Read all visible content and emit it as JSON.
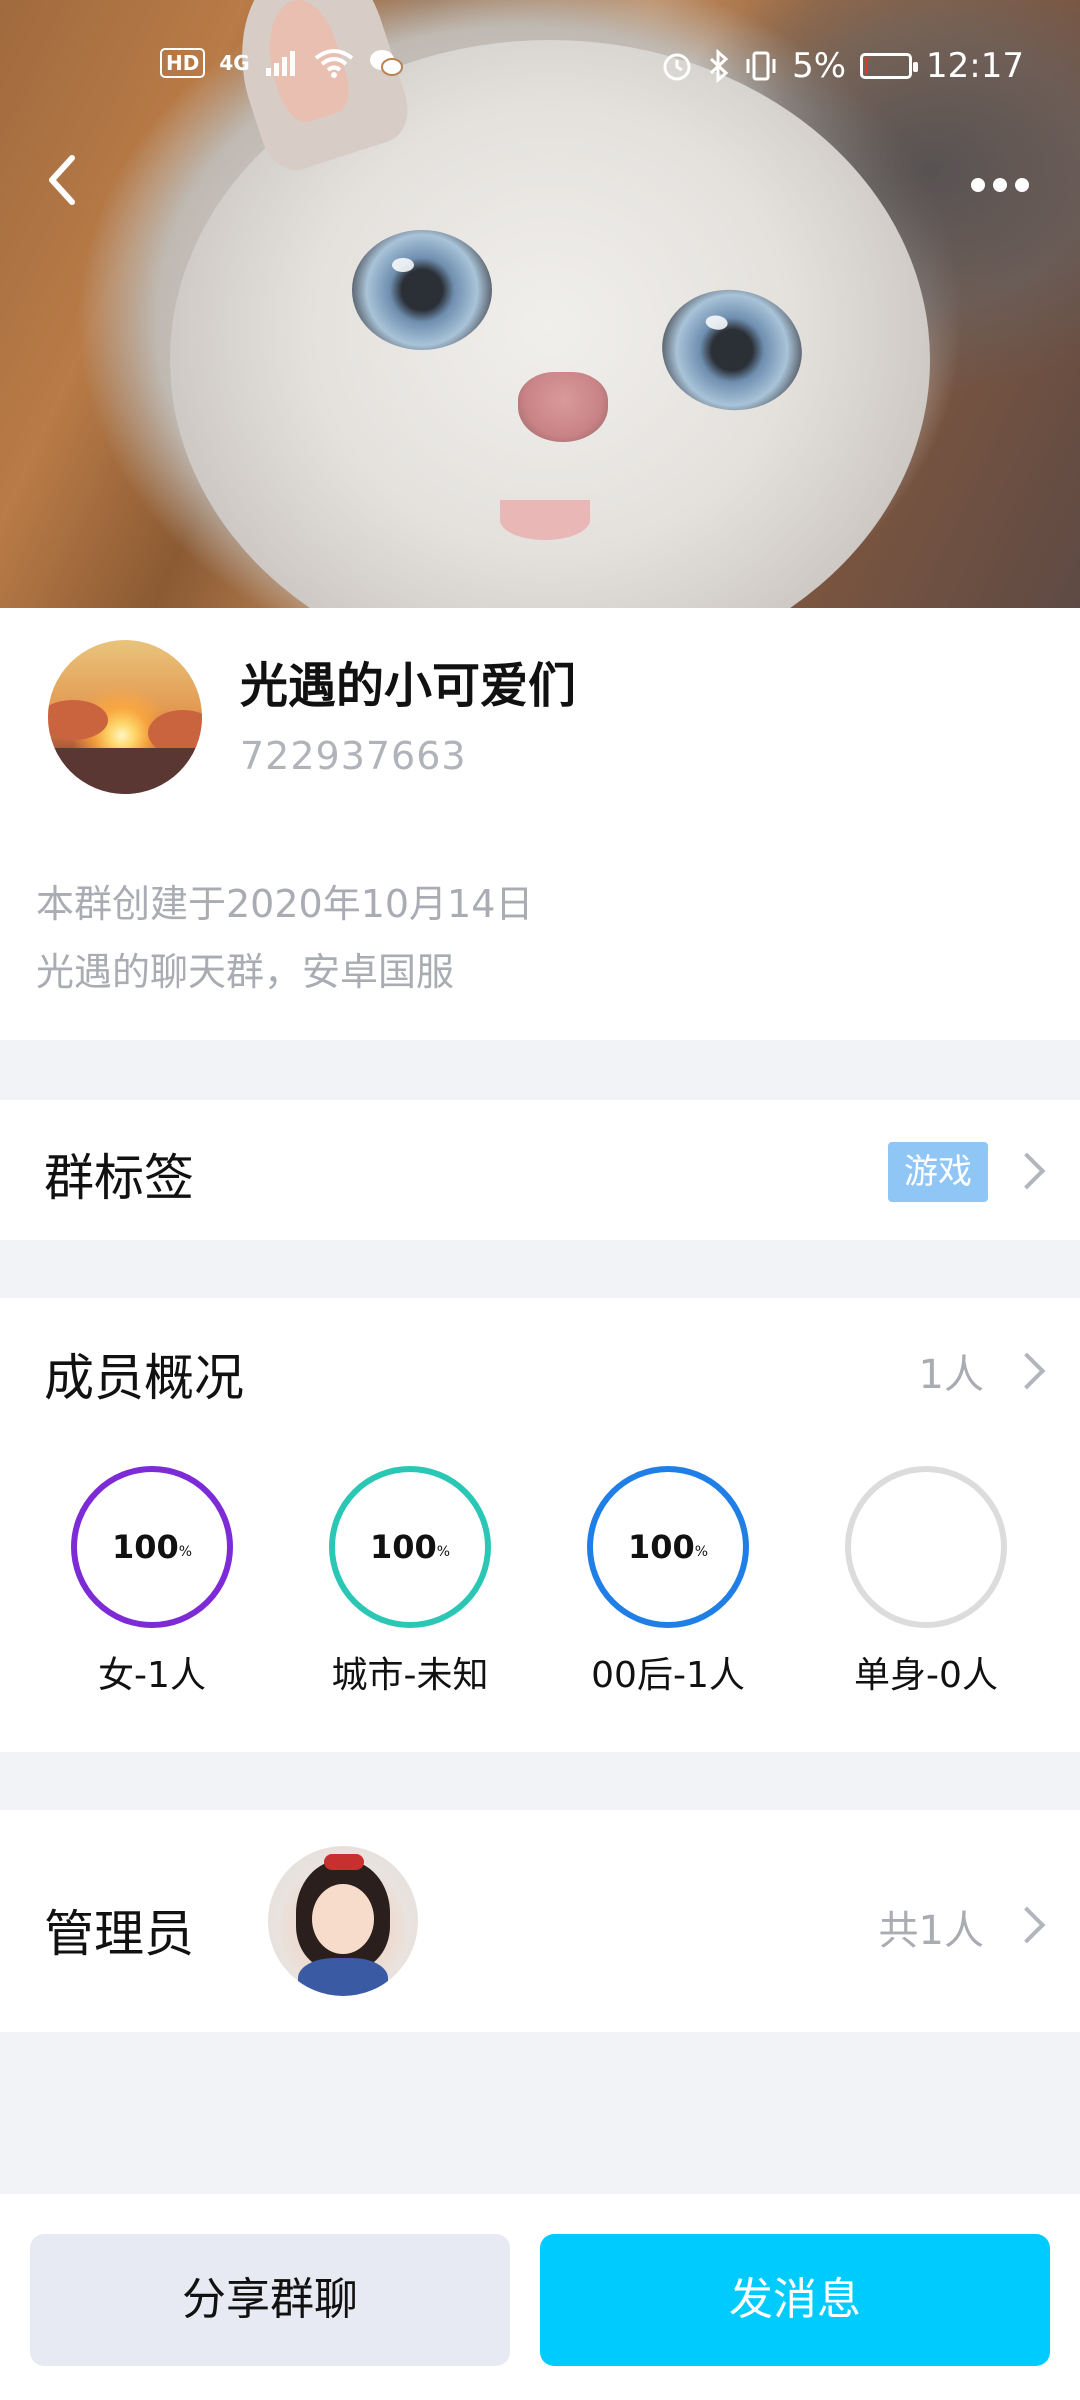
{
  "status_bar": {
    "hd": "HD",
    "network": "4G",
    "battery_percent": "5%",
    "time": "12:17",
    "icons": [
      "signal-icon",
      "wifi-icon",
      "wechat-icon",
      "alarm-icon",
      "bluetooth-icon",
      "vibrate-icon",
      "battery-icon"
    ]
  },
  "header": {
    "back_icon": "back-chevron-icon",
    "more_icon": "more-dots-icon"
  },
  "group": {
    "name": "光遇的小可爱们",
    "id": "722937663",
    "created": "本群创建于2020年10月14日",
    "intro": "光遇的聊天群，安卓国服"
  },
  "tags": {
    "title": "群标签",
    "items": [
      "游戏"
    ]
  },
  "members": {
    "title": "成员概况",
    "count": "1人",
    "stats": [
      {
        "value": "100",
        "unit": "%",
        "label": "女-1人",
        "color": "#7c2bd6",
        "fraction": 1.0
      },
      {
        "value": "100",
        "unit": "%",
        "label": "城市-未知",
        "color": "#2ac7b4",
        "fraction": 1.0
      },
      {
        "value": "100",
        "unit": "%",
        "label": "00后-1人",
        "color": "#1f7fe6",
        "fraction": 1.0
      },
      {
        "value": "",
        "unit": "",
        "label": "单身-0人",
        "color": "#dcdcdc",
        "fraction": 0.0
      }
    ]
  },
  "admins": {
    "title": "管理员",
    "count": "共1人"
  },
  "actions": {
    "share": "分享群聊",
    "send": "发消息"
  }
}
